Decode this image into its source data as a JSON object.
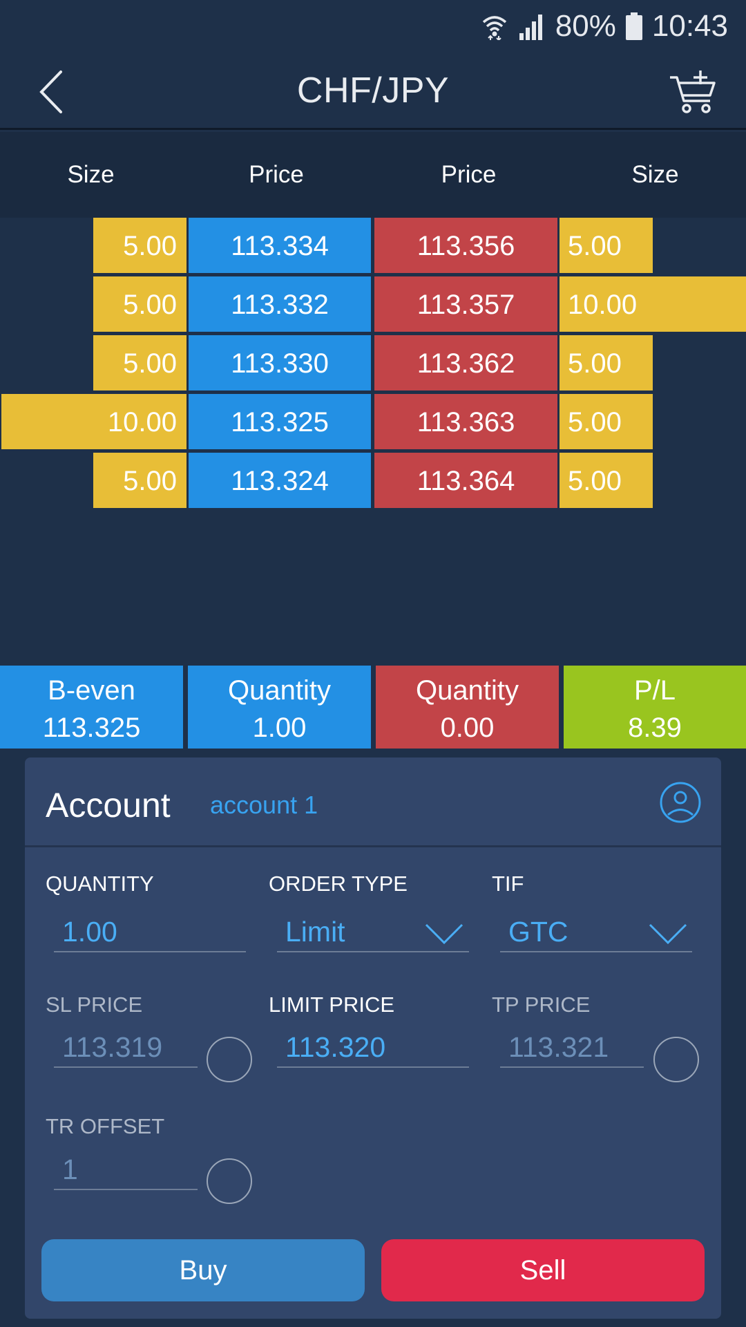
{
  "status_bar": {
    "battery": "80%",
    "time": "10:43",
    "icons": [
      "wifi-icon",
      "signal-icon",
      "battery-icon"
    ]
  },
  "header": {
    "title": "CHF/JPY",
    "back_icon": "back-arrow-icon",
    "cart_icon": "cart-add-icon"
  },
  "columns": {
    "bid_size": "Size",
    "bid_price": "Price",
    "ask_price": "Price",
    "ask_size": "Size"
  },
  "order_book": {
    "rows": [
      {
        "bid_size": "5.00",
        "bid_price": "113.334",
        "ask_price": "113.356",
        "ask_size": "5.00"
      },
      {
        "bid_size": "5.00",
        "bid_price": "113.332",
        "ask_price": "113.357",
        "ask_size": "10.00"
      },
      {
        "bid_size": "5.00",
        "bid_price": "113.330",
        "ask_price": "113.362",
        "ask_size": "5.00"
      },
      {
        "bid_size": "10.00",
        "bid_price": "113.325",
        "ask_price": "113.363",
        "ask_size": "5.00"
      },
      {
        "bid_size": "5.00",
        "bid_price": "113.324",
        "ask_price": "113.364",
        "ask_size": "5.00"
      }
    ]
  },
  "summary": {
    "breakeven": {
      "label": "B-even",
      "value": "113.325"
    },
    "buy_quantity": {
      "label": "Quantity",
      "value": "1.00"
    },
    "sell_quantity": {
      "label": "Quantity",
      "value": "0.00"
    },
    "pl": {
      "label": "P/L",
      "value": "8.39"
    }
  },
  "account": {
    "title": "Account",
    "name": "account 1",
    "icon": "user-circle-icon"
  },
  "form": {
    "quantity": {
      "label": "QUANTITY",
      "value": "1.00"
    },
    "order_type": {
      "label": "ORDER TYPE",
      "value": "Limit"
    },
    "tif": {
      "label": "TIF",
      "value": "GTC"
    },
    "sl_price": {
      "label": "SL PRICE",
      "value": "113.319"
    },
    "limit_price": {
      "label": "LIMIT PRICE",
      "value": "113.320"
    },
    "tp_price": {
      "label": "TP PRICE",
      "value": "113.321"
    },
    "tr_offset": {
      "label": "TR OFFSET",
      "value": "1"
    }
  },
  "actions": {
    "buy": "Buy",
    "sell": "Sell"
  },
  "colors": {
    "background": "#1e3049",
    "size_bar": "#e8be37",
    "bid": "#2390e4",
    "ask": "#c24448",
    "profit": "#99c51f",
    "panel": "#32466a",
    "accent_text": "#4aaef5",
    "buy_button": "#3784c4",
    "sell_button": "#e1294b"
  }
}
